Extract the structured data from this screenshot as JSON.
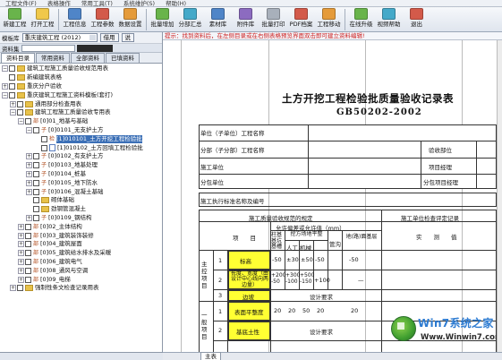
{
  "menubar": [
    "工程文件(F)",
    "表格操作",
    "常用工具(T)",
    "系统维护(S)",
    "帮助(H)"
  ],
  "toolbar": [
    {
      "label": "新建工程",
      "icon": "new-project-icon",
      "color": "grn"
    },
    {
      "label": "打开工程",
      "icon": "open-project-icon",
      "color": "yel"
    },
    {
      "label": "工程信息",
      "icon": "project-info-icon",
      "color": "blu"
    },
    {
      "label": "工程参数",
      "icon": "project-params-icon",
      "color": "red"
    },
    {
      "label": "数据设置",
      "icon": "data-settings-icon",
      "color": "org"
    },
    {
      "label": "批量增加",
      "icon": "batch-add-icon",
      "color": "grn"
    },
    {
      "label": "分部汇总",
      "icon": "summary-icon",
      "color": "cya"
    },
    {
      "label": "素材库",
      "icon": "material-library-icon",
      "color": "blu"
    },
    {
      "label": "附件库",
      "icon": "attachment-library-icon",
      "color": "pur"
    },
    {
      "label": "批量打印",
      "icon": "batch-print-icon",
      "color": "gry"
    },
    {
      "label": "PDF档案",
      "icon": "pdf-archive-icon",
      "color": "red"
    },
    {
      "label": "工程移动",
      "icon": "project-move-icon",
      "color": "org"
    },
    {
      "label": "在线升级",
      "icon": "online-upgrade-icon",
      "color": "grn"
    },
    {
      "label": "视频帮助",
      "icon": "video-help-icon",
      "color": "cya"
    },
    {
      "label": "退出",
      "icon": "exit-icon",
      "color": "red"
    }
  ],
  "left": {
    "module_caption": "模板库",
    "module_value": "重庆建筑工程 (2012)",
    "module_btn": "借用",
    "module_btn2": "说",
    "search_caption": "资料集",
    "tabs": [
      "资料目录",
      "常用资料",
      "全部资料",
      "已填资料"
    ],
    "tree": [
      {
        "indent": 0,
        "exp": "−",
        "cb": true,
        "icon": "folder",
        "text": "建筑工程施工质量验收规范用表"
      },
      {
        "indent": 0,
        "exp": "",
        "cb": true,
        "icon": "folder",
        "text": "新编建筑表格"
      },
      {
        "indent": 0,
        "exp": "+",
        "cb": true,
        "icon": "folder",
        "text": "重庆分户验收"
      },
      {
        "indent": 0,
        "exp": "−",
        "cb": true,
        "icon": "folder",
        "text": "重庆建筑工程施工资料模板(套打)"
      },
      {
        "indent": 1,
        "exp": "+",
        "cb": true,
        "icon": "folder",
        "text": "通用部分检查用表"
      },
      {
        "indent": 1,
        "exp": "−",
        "cb": true,
        "icon": "folder",
        "text": "建筑工程施工质量验收专用表"
      },
      {
        "indent": 2,
        "exp": "−",
        "cb": true,
        "tag": "部",
        "text": "[0]01_地基与基础"
      },
      {
        "indent": 3,
        "exp": "−",
        "cb": true,
        "tag": "子",
        "text": "[0]0101_无支护土方"
      },
      {
        "indent": 4,
        "exp": "",
        "cb": true,
        "tag": "检",
        "text": "[1]010101_土方开挖工程检验批",
        "sel": true
      },
      {
        "indent": 4,
        "exp": "",
        "cb": true,
        "tag": "",
        "text": "[1]010102_土方回填工程检验批"
      },
      {
        "indent": 3,
        "exp": "+",
        "cb": true,
        "tag": "子",
        "text": "[0]0102_有支护土方"
      },
      {
        "indent": 3,
        "exp": "+",
        "cb": true,
        "tag": "子",
        "text": "[0]0103_地基处理"
      },
      {
        "indent": 3,
        "exp": "+",
        "cb": true,
        "tag": "子",
        "text": "[0]0104_桩基"
      },
      {
        "indent": 3,
        "exp": "+",
        "cb": true,
        "tag": "子",
        "text": "[0]0105_地下防水"
      },
      {
        "indent": 3,
        "exp": "+",
        "cb": true,
        "tag": "子",
        "text": "[0]0106_混凝土基础"
      },
      {
        "indent": 3,
        "exp": "",
        "cb": true,
        "icon": "folder",
        "text": "砌体基础"
      },
      {
        "indent": 3,
        "exp": "",
        "cb": true,
        "icon": "folder",
        "text": "劲钢管混凝土"
      },
      {
        "indent": 3,
        "exp": "+",
        "cb": true,
        "tag": "子",
        "text": "[0]0109_钢结构"
      },
      {
        "indent": 2,
        "exp": "+",
        "cb": true,
        "tag": "部",
        "text": "[0]02_主体结构"
      },
      {
        "indent": 2,
        "exp": "+",
        "cb": true,
        "tag": "部",
        "text": "[0]03_建筑装饰装修"
      },
      {
        "indent": 2,
        "exp": "+",
        "cb": true,
        "tag": "部",
        "text": "[0]04_建筑屋面"
      },
      {
        "indent": 2,
        "exp": "+",
        "cb": true,
        "tag": "部",
        "text": "[0]05_建筑给水排水及采暖"
      },
      {
        "indent": 2,
        "exp": "+",
        "cb": true,
        "tag": "部",
        "text": "[0]06_建筑电气"
      },
      {
        "indent": 2,
        "exp": "+",
        "cb": true,
        "tag": "部",
        "text": "[0]08_通风与空调"
      },
      {
        "indent": 2,
        "exp": "+",
        "cb": true,
        "tag": "部",
        "text": "[0]09_电梯"
      },
      {
        "indent": 1,
        "exp": "+",
        "cb": true,
        "icon": "folder",
        "text": "强制性条文检查记录用表"
      }
    ]
  },
  "right": {
    "hint": "提示：找到资料后，在左侧目录或在右侧表格预览界面双击即可建立资料编辑!",
    "title": "土方开挖工程检验批质量验收记录表",
    "subtitle": "GB50202-2002",
    "labels": {
      "unit_project": "单位（子单位）工程名称",
      "sub_project": "分部（子分部）工程名称",
      "accept_part": "验收部位",
      "construct_unit": "施工单位",
      "project_manager": "项目经理",
      "subcontract_unit": "分包单位",
      "sub_manager": "分包项目经理",
      "standard": "施工执行标准名称及编号",
      "spec_head": "施工质量验收规范的规定",
      "allow": "允许偏差或允许值（mm）",
      "check_record": "施工单位检查评定记录",
      "item": "项　　目",
      "measured": "实　　测　　值",
      "col_a": "柱基基坑基槽",
      "col_b_top": "挖方场地平整",
      "col_b1": "人工",
      "col_b2": "机械",
      "col_c": "管沟",
      "col_d": "地(路)面基层",
      "main_ctrl": "主控项目",
      "general": "一般项目",
      "r1_no": "1",
      "r1_name": "标高",
      "r1_a": "-50",
      "r1_b1": "±30",
      "r1_b2": "±50",
      "r1_c": "-50",
      "r1_d": "-50",
      "r2_no": "2",
      "r2_name": "长度、宽度（由设计中心线向两边量）",
      "r2_a": "+200 -50",
      "r2_b1": "+300 -100",
      "r2_b2": "+500 -150",
      "r2_c": "+100",
      "r2_d": "—",
      "r3_no": "3",
      "r3_name": "边坡",
      "r3_val": "设计要求",
      "g1_no": "1",
      "g1_name": "表面平整度",
      "g1_a": "20",
      "g1_b1": "20",
      "g1_b2": "50",
      "g1_c": "20",
      "g1_d": "20",
      "g2_no": "2",
      "g2_name": "基底土性",
      "g2_val": "设计要求"
    },
    "sheet_tab": "主表"
  },
  "watermark": {
    "brand": "Win7系统之家",
    "url": "Www.Winwin7.com"
  }
}
